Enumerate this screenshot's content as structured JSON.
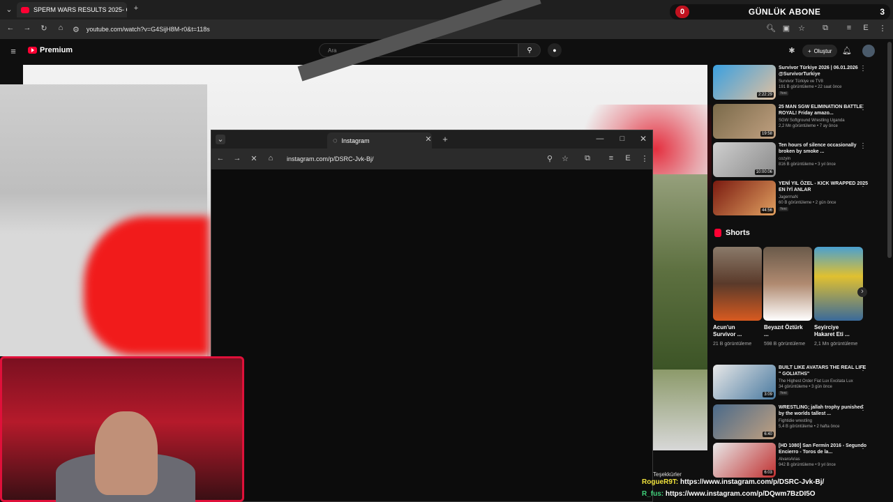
{
  "browser": {
    "tab_title": "SPERM WARS RESULTS 2025- C",
    "url": "youtube.com/watch?v=G4SijH8M-r0&t=118s"
  },
  "abone_widget": {
    "left_count": "0",
    "title": "GÜNLÜK ABONE",
    "right_count": "3"
  },
  "youtube": {
    "brand": "Premium",
    "search_placeholder": "Ara",
    "create_label": "Oluştur"
  },
  "popup": {
    "tab_title": "Instagram",
    "url": "instagram.com/p/DSRC-Jvk-Bj/"
  },
  "recommendations": [
    {
      "title": "Survivor Türkiye 2026 | 06.01.2026 @SurvivorTurkiye",
      "channel": "Survivor Türkiye ve TV8",
      "meta": "191 B görüntüleme • 22 saat önce",
      "badge": "Yeni",
      "duration": "2:22:29"
    },
    {
      "title": "25 MAN SGW ELIMINATION BATTLE ROYAL! Friday amazo...",
      "channel": "SGW Softground Wrestling Uganda",
      "meta": "2,2 Mn görüntüleme • 7 ay önce",
      "badge": "",
      "duration": "19:58"
    },
    {
      "title": "Ten hours of silence occasionally broken by smoke ...",
      "channel": "cozyin",
      "meta": "816 B görüntüleme • 3 yıl önce",
      "badge": "",
      "duration": "10:00:06"
    },
    {
      "title": "YENİ YIL ÖZEL - KICK WRAPPED 2025 EN İYİ ANLAR",
      "channel": "JagermaN",
      "meta": "60 B görüntüleme • 2 gün önce",
      "badge": "Yeni",
      "duration": "44:56"
    }
  ],
  "shorts": {
    "heading": "Shorts",
    "items": [
      {
        "title": "Acun'un Survivor ...",
        "views": "21 B görüntüleme"
      },
      {
        "title": "Beyazıt Öztürk ...",
        "views": "598 B görüntüleme"
      },
      {
        "title": "Seyirciye Hakaret Eti ...",
        "views": "2,1 Mn görüntüleme"
      }
    ]
  },
  "more_recommendations": [
    {
      "title": "BUILT LIKE AVATARS THE REAL LIFE \" GOLIATHS\"",
      "channel": "The Highest Order Fiat Lux Excitata Lux",
      "meta": "34 görüntüleme • 3 gün önce",
      "badge": "Yeni",
      "duration": "3:09"
    },
    {
      "title": "WRESTLING; jallah trophy punished by the worlds tallest ...",
      "channel": "Fightidie wrestling",
      "meta": "5,4 B görüntüleme • 2 hafta önce",
      "badge": "",
      "duration": "6:40"
    },
    {
      "title": "[HD 1080] San Fermín 2016 - Segundo Encierro - Toros de la...",
      "channel": "AlvaroArias",
      "meta": "942 B görüntüleme • 9 yıl önce",
      "badge": "",
      "duration": "6:03"
    }
  ],
  "chat": [
    {
      "user": "RogueR9T:",
      "msg": "https://www.instagram.com/p/DSRC-Jvk-Bj/",
      "color": "#f0e23c"
    },
    {
      "user": "R_fus:",
      "msg": "https://www.instagram.com/p/DQwm7BzDI5O",
      "color": "#3fd17a"
    }
  ],
  "thanks_label": "Teşekkürler",
  "colors": {
    "accent": "#ff0033",
    "cam_border": "#e0103a"
  }
}
